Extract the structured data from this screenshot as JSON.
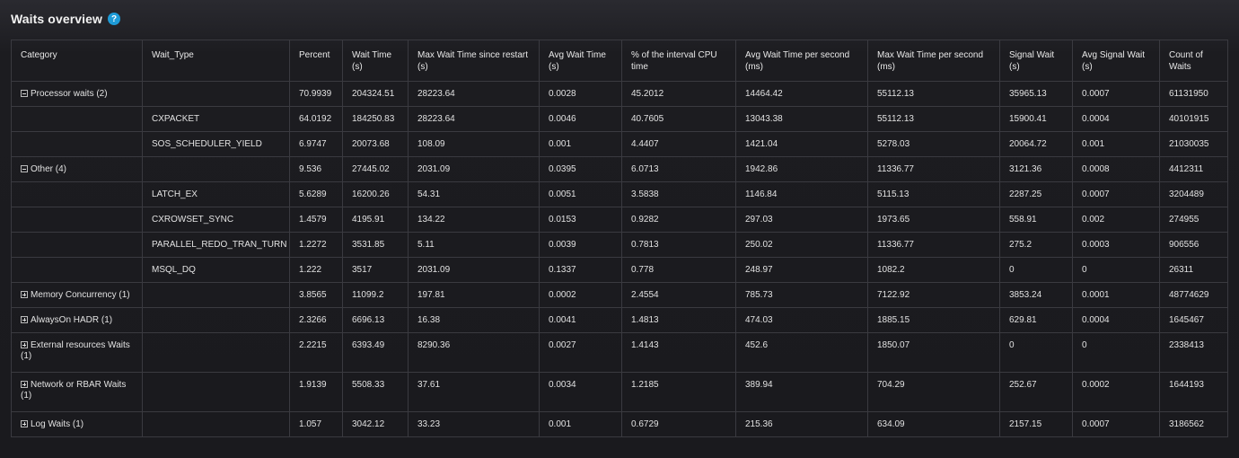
{
  "header": {
    "title": "Waits overview",
    "help_icon": "?"
  },
  "table": {
    "columns": [
      "Category",
      "Wait_Type",
      "Percent",
      "Wait Time (s)",
      "Max Wait Time since restart (s)",
      "Avg Wait Time (s)",
      "% of the interval CPU time",
      "Avg Wait Time per second (ms)",
      "Max Wait Time per second (ms)",
      "Signal Wait (s)",
      "Avg Signal Wait (s)",
      "Count of Waits"
    ],
    "rows": [
      {
        "expander": "minus",
        "category": "Processor waits (2)",
        "wait_type": "",
        "values": [
          "70.9939",
          "204324.51",
          "28223.64",
          "0.0028",
          "45.2012",
          "14464.42",
          "55112.13",
          "35965.13",
          "0.0007",
          "61131950"
        ]
      },
      {
        "expander": "",
        "category": "",
        "wait_type": "CXPACKET",
        "values": [
          "64.0192",
          "184250.83",
          "28223.64",
          "0.0046",
          "40.7605",
          "13043.38",
          "55112.13",
          "15900.41",
          "0.0004",
          "40101915"
        ]
      },
      {
        "expander": "",
        "category": "",
        "wait_type": "SOS_SCHEDULER_YIELD",
        "values": [
          "6.9747",
          "20073.68",
          "108.09",
          "0.001",
          "4.4407",
          "1421.04",
          "5278.03",
          "20064.72",
          "0.001",
          "21030035"
        ]
      },
      {
        "expander": "minus",
        "category": "Other (4)",
        "wait_type": "",
        "values": [
          "9.536",
          "27445.02",
          "2031.09",
          "0.0395",
          "6.0713",
          "1942.86",
          "11336.77",
          "3121.36",
          "0.0008",
          "4412311"
        ]
      },
      {
        "expander": "",
        "category": "",
        "wait_type": "LATCH_EX",
        "values": [
          "5.6289",
          "16200.26",
          "54.31",
          "0.0051",
          "3.5838",
          "1146.84",
          "5115.13",
          "2287.25",
          "0.0007",
          "3204489"
        ]
      },
      {
        "expander": "",
        "category": "",
        "wait_type": "CXROWSET_SYNC",
        "values": [
          "1.4579",
          "4195.91",
          "134.22",
          "0.0153",
          "0.9282",
          "297.03",
          "1973.65",
          "558.91",
          "0.002",
          "274955"
        ]
      },
      {
        "expander": "",
        "category": "",
        "wait_type": "PARALLEL_REDO_TRAN_TURN",
        "values": [
          "1.2272",
          "3531.85",
          "5.11",
          "0.0039",
          "0.7813",
          "250.02",
          "11336.77",
          "275.2",
          "0.0003",
          "906556"
        ]
      },
      {
        "expander": "",
        "category": "",
        "wait_type": "MSQL_DQ",
        "values": [
          "1.222",
          "3517",
          "2031.09",
          "0.1337",
          "0.778",
          "248.97",
          "1082.2",
          "0",
          "0",
          "26311"
        ]
      },
      {
        "expander": "plus",
        "category": "Memory Concurrency (1)",
        "wait_type": "",
        "values": [
          "3.8565",
          "11099.2",
          "197.81",
          "0.0002",
          "2.4554",
          "785.73",
          "7122.92",
          "3853.24",
          "0.0001",
          "48774629"
        ]
      },
      {
        "expander": "plus",
        "category": "AlwaysOn HADR (1)",
        "wait_type": "",
        "values": [
          "2.3266",
          "6696.13",
          "16.38",
          "0.0041",
          "1.4813",
          "474.03",
          "1885.15",
          "629.81",
          "0.0004",
          "1645467"
        ]
      },
      {
        "expander": "plus",
        "category": "External resources Waits (1)",
        "wait_type": "",
        "values": [
          "2.2215",
          "6393.49",
          "8290.36",
          "0.0027",
          "1.4143",
          "452.6",
          "1850.07",
          "0",
          "0",
          "2338413"
        ]
      },
      {
        "expander": "plus",
        "category": "Network or RBAR Waits (1)",
        "wait_type": "",
        "values": [
          "1.9139",
          "5508.33",
          "37.61",
          "0.0034",
          "1.2185",
          "389.94",
          "704.29",
          "252.67",
          "0.0002",
          "1644193"
        ]
      },
      {
        "expander": "plus",
        "category": "Log Waits (1)",
        "wait_type": "",
        "values": [
          "1.057",
          "3042.12",
          "33.23",
          "0.001",
          "0.6729",
          "215.36",
          "634.09",
          "2157.15",
          "0.0007",
          "3186562"
        ]
      }
    ]
  },
  "colors": {
    "accent": "#1e9bd7",
    "border": "#3a3a40",
    "background": "#1c1c20"
  }
}
